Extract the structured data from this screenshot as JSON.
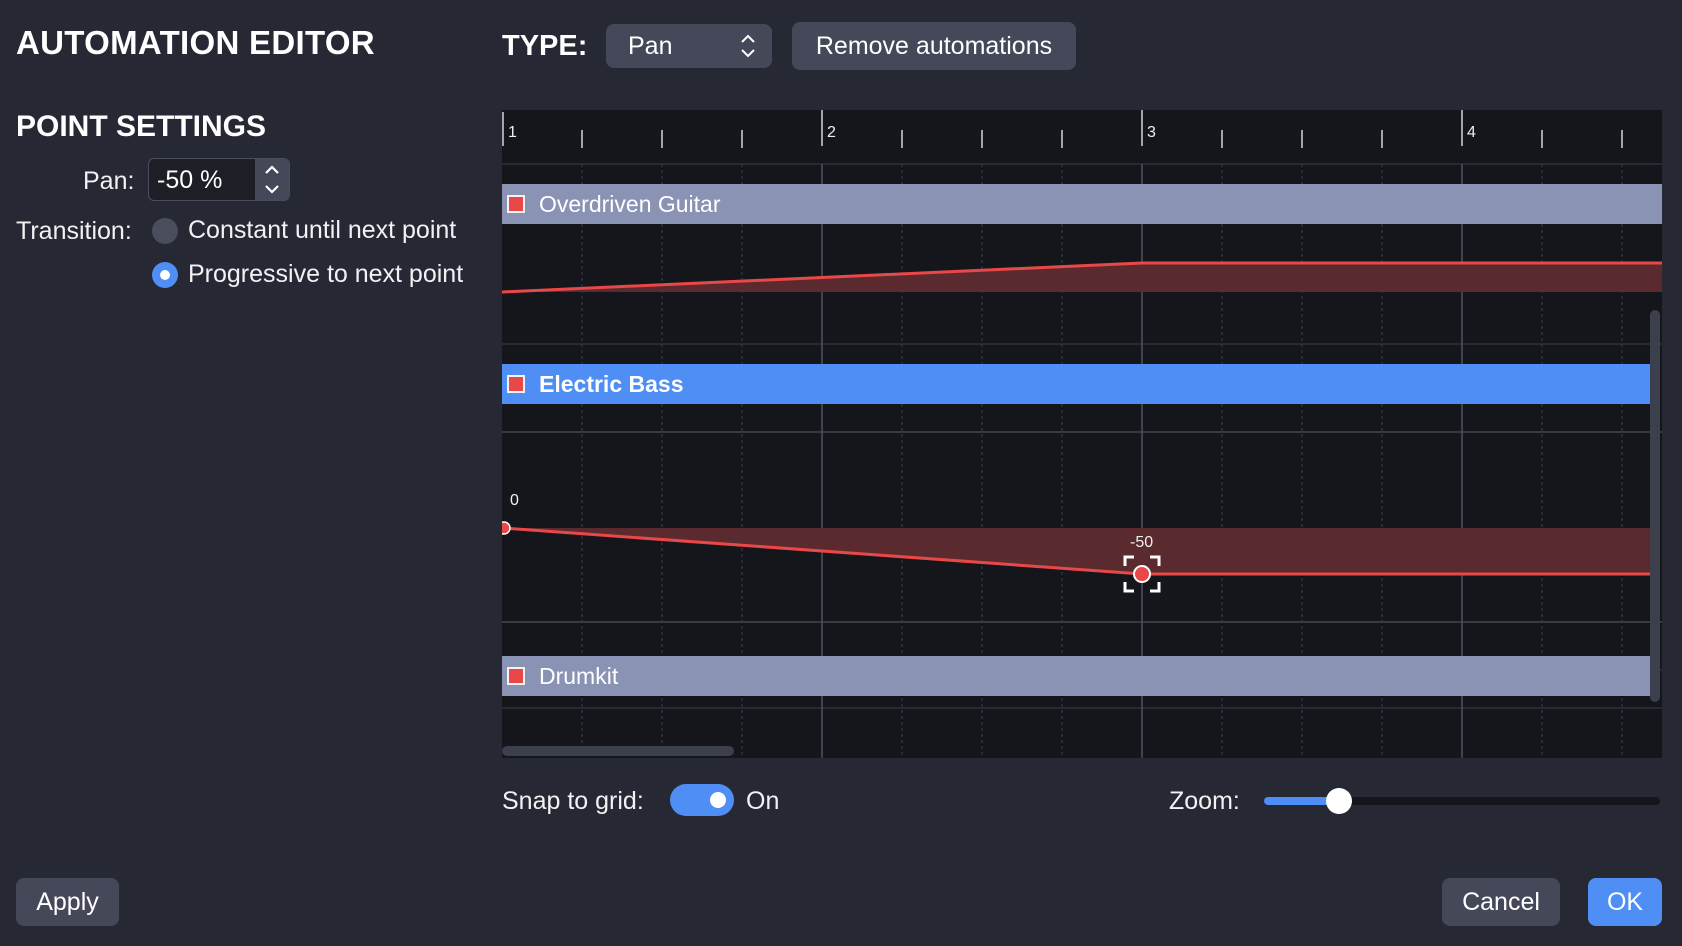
{
  "dialog": {
    "title": "AUTOMATION EDITOR",
    "accent_color": "#4f8ef5",
    "automation_color": "#e84848"
  },
  "point_settings": {
    "title": "POINT SETTINGS",
    "pan_label": "Pan:",
    "pan_value": "-50 %",
    "transition_label": "Transition:",
    "transition_options": [
      {
        "label": "Constant until next point",
        "selected": false
      },
      {
        "label": "Progressive to next point",
        "selected": true
      }
    ]
  },
  "type": {
    "label": "TYPE:",
    "selected": "Pan",
    "remove_button": "Remove automations"
  },
  "timeline": {
    "bars": [
      "1",
      "2",
      "3",
      "4"
    ],
    "tracks": [
      {
        "name": "Overdriven Guitar",
        "active": false
      },
      {
        "name": "Electric Bass",
        "active": true,
        "point_labels": [
          "0",
          "-50"
        ]
      },
      {
        "name": "Drumkit",
        "active": false
      }
    ]
  },
  "snap": {
    "label": "Snap to grid:",
    "state": "On",
    "enabled": true
  },
  "zoom": {
    "label": "Zoom:",
    "level": 0.19
  },
  "footer": {
    "apply": "Apply",
    "cancel": "Cancel",
    "ok": "OK"
  }
}
